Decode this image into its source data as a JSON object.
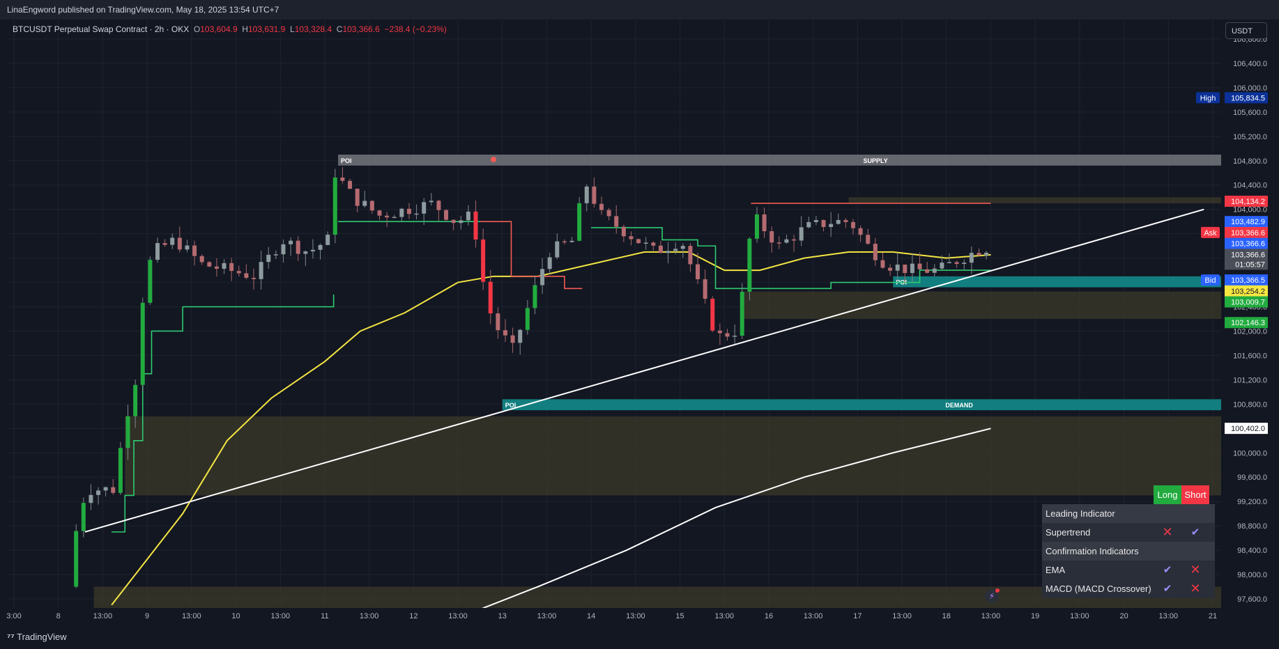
{
  "header": {
    "published": "LinaEngword published on TradingView.com, May 18, 2025 13:54 UTC+7"
  },
  "symbol": {
    "name": "BTCUSDT Perpetual Swap Contract · 2h · OKX",
    "o_label": "O",
    "o_value": "103,604.9",
    "h_label": "H",
    "h_value": "103,631.9",
    "l_label": "L",
    "l_value": "103,328.4",
    "c_label": "C",
    "c_value": "103,366.6",
    "change": "−238.4 (−0.23%)"
  },
  "currency": "USDT",
  "footer": {
    "brand": "TradingView"
  },
  "colors": {
    "background": "#131722",
    "up": "#22ab3f",
    "down": "#f23645",
    "ema_yellow": "#f5e642",
    "white_line": "#ffffff",
    "supertrend_green": "#2ecc71",
    "supertrend_red": "#f25c54",
    "demand_zone": "#138a8a",
    "supply_zone": "#6e7077",
    "olive_zone": "#3b3a2a"
  },
  "chart_data": {
    "type": "candlestick",
    "symbol": "BTCUSDT Perpetual Swap Contract",
    "timeframe": "2h",
    "exchange": "OKX",
    "ylim": [
      97400,
      107000
    ],
    "y_ticks": [
      97600,
      98000,
      98400,
      98800,
      99200,
      99600,
      100000,
      100400,
      100800,
      101200,
      101600,
      102000,
      102400,
      102800,
      103200,
      103600,
      104000,
      104400,
      104800,
      105200,
      105600,
      106000,
      106400,
      106800
    ],
    "y_tick_labels": [
      "97,600.0",
      "98,000.0",
      "98,400.0",
      "98,800.0",
      "99,200.0",
      "99,600.0",
      "100,000.0",
      "100,400.0",
      "100,800.0",
      "101,200.0",
      "101,600.0",
      "102,000.0",
      "102,400.0",
      "102,800.0",
      "103,200.0",
      "103,600.0",
      "104,000.0",
      "104,400.0",
      "104,800.0",
      "105,200.0",
      "105,600.0",
      "106,000.0",
      "106,400.0",
      "106,800.0"
    ],
    "x_ticks": [
      {
        "label": "3:00",
        "t": -0.9
      },
      {
        "label": "8",
        "t": -0.4
      },
      {
        "label": "13:00",
        "t": 0.1
      },
      {
        "label": "9",
        "t": 0.6
      },
      {
        "label": "13:00",
        "t": 1.1
      },
      {
        "label": "10",
        "t": 1.6
      },
      {
        "label": "13:00",
        "t": 2.1
      },
      {
        "label": "11",
        "t": 2.6
      },
      {
        "label": "13:00",
        "t": 3.1
      },
      {
        "label": "12",
        "t": 3.6
      },
      {
        "label": "13:00",
        "t": 4.1
      },
      {
        "label": "13",
        "t": 4.6
      },
      {
        "label": "13:00",
        "t": 5.1
      },
      {
        "label": "14",
        "t": 5.6
      },
      {
        "label": "13:00",
        "t": 6.1
      },
      {
        "label": "15",
        "t": 6.6
      },
      {
        "label": "13:00",
        "t": 7.1
      },
      {
        "label": "16",
        "t": 7.6
      },
      {
        "label": "13:00",
        "t": 8.1
      },
      {
        "label": "17",
        "t": 8.6
      },
      {
        "label": "13:00",
        "t": 9.1
      },
      {
        "label": "18",
        "t": 9.6
      },
      {
        "label": "13:00",
        "t": 10.1
      },
      {
        "label": "19",
        "t": 10.6
      },
      {
        "label": "13:00",
        "t": 11.1
      },
      {
        "label": "20",
        "t": 11.6
      },
      {
        "label": "13:00",
        "t": 12.1
      },
      {
        "label": "21",
        "t": 12.6
      }
    ],
    "candle_keypoints": [
      {
        "t": -0.2,
        "p": 97800
      },
      {
        "t": -0.1,
        "p": 98900
      },
      {
        "t": 0.0,
        "p": 99400
      },
      {
        "t": 0.3,
        "p": 99400
      },
      {
        "t": 0.45,
        "p": 100600
      },
      {
        "t": 0.55,
        "p": 101200
      },
      {
        "t": 0.65,
        "p": 102800
      },
      {
        "t": 0.75,
        "p": 103300
      },
      {
        "t": 1.0,
        "p": 103500
      },
      {
        "t": 1.3,
        "p": 103100
      },
      {
        "t": 1.6,
        "p": 103000
      },
      {
        "t": 1.9,
        "p": 102900
      },
      {
        "t": 2.2,
        "p": 103500
      },
      {
        "t": 2.5,
        "p": 103300
      },
      {
        "t": 2.72,
        "p": 103500
      },
      {
        "t": 2.8,
        "p": 104600
      },
      {
        "t": 3.0,
        "p": 104200
      },
      {
        "t": 3.3,
        "p": 103900
      },
      {
        "t": 3.6,
        "p": 104000
      },
      {
        "t": 3.9,
        "p": 104100
      },
      {
        "t": 4.15,
        "p": 103800
      },
      {
        "t": 4.35,
        "p": 103900
      },
      {
        "t": 4.5,
        "p": 102500
      },
      {
        "t": 4.6,
        "p": 102100
      },
      {
        "t": 4.8,
        "p": 101700
      },
      {
        "t": 5.0,
        "p": 102500
      },
      {
        "t": 5.2,
        "p": 103300
      },
      {
        "t": 5.5,
        "p": 103500
      },
      {
        "t": 5.6,
        "p": 104500
      },
      {
        "t": 5.8,
        "p": 103900
      },
      {
        "t": 6.1,
        "p": 103600
      },
      {
        "t": 6.4,
        "p": 103300
      },
      {
        "t": 6.7,
        "p": 103500
      },
      {
        "t": 6.9,
        "p": 102700
      },
      {
        "t": 7.1,
        "p": 101900
      },
      {
        "t": 7.3,
        "p": 102000
      },
      {
        "t": 7.4,
        "p": 102700
      },
      {
        "t": 7.5,
        "p": 103900
      },
      {
        "t": 7.8,
        "p": 103400
      },
      {
        "t": 8.1,
        "p": 103700
      },
      {
        "t": 8.4,
        "p": 103800
      },
      {
        "t": 8.6,
        "p": 103800
      },
      {
        "t": 8.8,
        "p": 103400
      },
      {
        "t": 9.0,
        "p": 103100
      },
      {
        "t": 9.3,
        "p": 103000
      },
      {
        "t": 9.6,
        "p": 103000
      },
      {
        "t": 9.85,
        "p": 103200
      },
      {
        "t": 10.1,
        "p": 103367
      }
    ],
    "supertrend_green_segments": [
      {
        "start_t": 0.2,
        "end_t": 1.0,
        "steps": [
          [
            0.2,
            98700
          ],
          [
            0.35,
            99300
          ],
          [
            0.45,
            100200
          ],
          [
            0.55,
            101300
          ],
          [
            0.65,
            102000
          ],
          [
            0.8,
            102000
          ],
          [
            1.0,
            102400
          ]
        ]
      },
      {
        "start_t": 1.0,
        "end_t": 2.7,
        "steps": [
          [
            1.0,
            102400
          ],
          [
            2.7,
            102600
          ]
        ]
      },
      {
        "start_t": 2.75,
        "end_t": 4.35,
        "steps": [
          [
            2.75,
            103800
          ],
          [
            4.35,
            103800
          ]
        ]
      },
      {
        "start_t": 5.6,
        "end_t": 7.4,
        "steps": [
          [
            5.6,
            103700
          ],
          [
            6.2,
            103700
          ],
          [
            6.4,
            103500
          ],
          [
            6.8,
            103400
          ],
          [
            7.0,
            102700
          ],
          [
            7.4,
            102700
          ]
        ]
      },
      {
        "start_t": 7.4,
        "end_t": 10.1,
        "steps": [
          [
            7.4,
            102700
          ],
          [
            8.3,
            102800
          ],
          [
            9.3,
            103000
          ],
          [
            10.1,
            103000
          ]
        ]
      }
    ],
    "supertrend_red_segments": [
      {
        "start_t": 4.35,
        "end_t": 5.5,
        "steps": [
          [
            4.35,
            103800
          ],
          [
            4.7,
            102900
          ],
          [
            5.0,
            102900
          ],
          [
            5.3,
            102700
          ]
        ]
      },
      {
        "start_t": 7.4,
        "end_t": 10.1,
        "steps": [
          [
            7.4,
            104100
          ],
          [
            10.1,
            104100
          ]
        ]
      }
    ],
    "ema": [
      {
        "t": 0.2,
        "p": 97500
      },
      {
        "t": 1.0,
        "p": 99000
      },
      {
        "t": 1.5,
        "p": 100200
      },
      {
        "t": 2.0,
        "p": 100900
      },
      {
        "t": 2.6,
        "p": 101500
      },
      {
        "t": 3.0,
        "p": 102000
      },
      {
        "t": 3.5,
        "p": 102300
      },
      {
        "t": 4.1,
        "p": 102800
      },
      {
        "t": 4.5,
        "p": 102900
      },
      {
        "t": 5.0,
        "p": 102900
      },
      {
        "t": 5.6,
        "p": 103100
      },
      {
        "t": 6.2,
        "p": 103300
      },
      {
        "t": 6.7,
        "p": 103300
      },
      {
        "t": 7.1,
        "p": 103000
      },
      {
        "t": 7.5,
        "p": 103000
      },
      {
        "t": 8.0,
        "p": 103200
      },
      {
        "t": 8.5,
        "p": 103300
      },
      {
        "t": 9.0,
        "p": 103300
      },
      {
        "t": 9.6,
        "p": 103200
      },
      {
        "t": 10.1,
        "p": 103254
      }
    ],
    "long_ma": [
      {
        "t": 4.3,
        "p": 97400
      },
      {
        "t": 5.0,
        "p": 97800
      },
      {
        "t": 6.0,
        "p": 98400
      },
      {
        "t": 7.0,
        "p": 99100
      },
      {
        "t": 8.0,
        "p": 99600
      },
      {
        "t": 9.0,
        "p": 100000
      },
      {
        "t": 10.1,
        "p": 100400
      }
    ],
    "trendline": {
      "from": {
        "t": -0.1,
        "p": 98700
      },
      "to": {
        "t": 12.5,
        "p": 104000
      }
    },
    "zones": [
      {
        "label": "SUPPLY",
        "tag": "POI",
        "from_t": 2.75,
        "to_t": 12.8,
        "top": 104900,
        "bottom": 104720,
        "color": "#6e7077"
      },
      {
        "label": "DEMAND",
        "tag": "POI",
        "from_t": 4.6,
        "to_t": 12.8,
        "top": 100880,
        "bottom": 100700,
        "color": "#138a8a"
      },
      {
        "label": "",
        "tag": "POI",
        "from_t": 9.0,
        "to_t": 12.8,
        "top": 102900,
        "bottom": 102720,
        "color": "#138a8a"
      },
      {
        "label": "",
        "tag": "",
        "from_t": 0.35,
        "to_t": 12.8,
        "top": 100600,
        "bottom": 99300,
        "color": "#3b3a2a"
      },
      {
        "label": "",
        "tag": "",
        "from_t": 7.3,
        "to_t": 12.8,
        "top": 102650,
        "bottom": 102200,
        "color": "#3b3a2a"
      },
      {
        "label": "",
        "tag": "",
        "from_t": 8.5,
        "to_t": 12.8,
        "top": 104200,
        "bottom": 104100,
        "color": "#3b3a2a"
      },
      {
        "label": "",
        "tag": "",
        "from_t": 0.0,
        "to_t": 12.8,
        "top": 97800,
        "bottom": 97400,
        "color": "#3b3a2a"
      }
    ],
    "price_labels": [
      {
        "text": "105,834.5",
        "price": 105834.5,
        "tag": "High",
        "color": "#0c3299"
      },
      {
        "text": "104,134.2",
        "price": 104134.2,
        "tag": "",
        "color": "#f23645"
      },
      {
        "text": "103,482.9",
        "price": 103800,
        "tag": "",
        "color": "#2962ff"
      },
      {
        "text": "103,366.6",
        "price": 103620,
        "tag": "Ask",
        "color": "#f23645"
      },
      {
        "text": "103,366.6",
        "price": 103440,
        "tag": "",
        "color": "#2962ff"
      },
      {
        "text": "103,366.6",
        "price": 103260,
        "tag": "",
        "color": "#4a4e59",
        "sub": "01:05:57"
      },
      {
        "text": "103,366.5",
        "price": 102840,
        "tag": "Bid",
        "color": "#2962ff"
      },
      {
        "text": "103,254.2",
        "price": 102660,
        "tag": "",
        "color": "#f5e642"
      },
      {
        "text": "103,009.7",
        "price": 102480,
        "tag": "",
        "color": "#22ab3f"
      },
      {
        "text": "102,146.3",
        "price": 102140,
        "tag": "",
        "color": "#22ab3f"
      },
      {
        "text": "100,402.0",
        "price": 100402,
        "tag": "",
        "color": "#ffffff"
      }
    ]
  },
  "signal_table": {
    "long_label": "Long",
    "short_label": "Short",
    "leading_header": "Leading Indicator",
    "confirm_header": "Confirmation Indicators",
    "rows": [
      {
        "name": "Supertrend",
        "long": "x",
        "short": "check"
      },
      {
        "name": "EMA",
        "long": "check",
        "short": "x"
      },
      {
        "name": "MACD (MACD Crossover)",
        "long": "check",
        "short": "x"
      }
    ]
  },
  "icons": {
    "x_glyph": "✕",
    "check_glyph": "✔",
    "zap_glyph": "⚡"
  }
}
